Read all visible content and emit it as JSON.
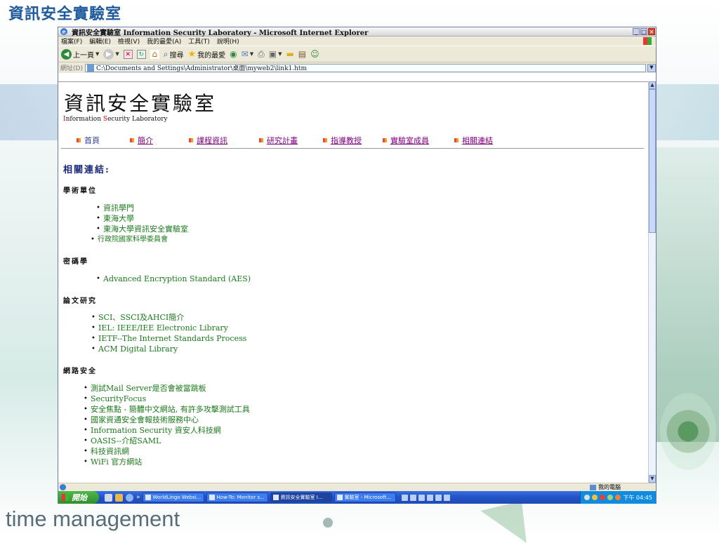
{
  "slide": {
    "title": "資訊安全實驗室",
    "footer": "time management"
  },
  "window": {
    "title": "資訊安全實驗室 Information Security Laboratory - Microsoft Internet Explorer",
    "menu": [
      "檔案(F)",
      "編輯(E)",
      "檢視(V)",
      "我的最愛(A)",
      "工具(T)",
      "說明(H)"
    ],
    "toolbar": {
      "back_label": "上一頁",
      "search_label": "搜尋",
      "favorites_label": "我的最愛"
    },
    "address": {
      "label": "網址(D)",
      "value": "C:\\Documents and Settings\\Administrator\\桌面\\myweb2\\link1.htm"
    }
  },
  "page": {
    "heading": "資訊安全實驗室",
    "subtitle_I": "I",
    "subtitle_rest1": "nformation ",
    "subtitle_S": "S",
    "subtitle_rest2": "ecurity Laboratory",
    "nav": [
      "首頁",
      "簡介",
      "課程資訊",
      "研究計畫",
      "指導教授",
      "實驗室成員",
      "相關連結"
    ],
    "section_title": "相關連結:",
    "categories": [
      {
        "name": "學術單位",
        "links": [
          "資訊學門",
          "東海大學",
          "東海大學資訊安全實驗室",
          "行政院國家科學委員會"
        ]
      },
      {
        "name": "密碼學",
        "links": [
          "Advanced Encryption Standard (AES)"
        ]
      },
      {
        "name": "論文研究",
        "links": [
          "SCI、SSCI及AHCI簡介",
          "IEL: IEEE/IEE Electronic Library",
          "IETF--The Internet Standards Process",
          "ACM Digital Library"
        ]
      },
      {
        "name": "網路安全",
        "links": [
          "測試Mail Server是否會被當跳板",
          "SecurityFocus",
          "安全焦點 - 簡體中文網站, 有許多攻擊測試工具",
          "國家資通安全會報技術服務中心",
          "Information Security 資安人科技網",
          "OASIS--介紹SAML",
          "科技資訊網",
          "WiFi 官方網站"
        ]
      }
    ]
  },
  "statusbar": {
    "zone": "我的電腦"
  },
  "taskbar": {
    "start_label": "開始",
    "buttons": [
      "WorldLingo Websi...",
      "How-To: Monitor s...",
      "資訊安全實驗室 I...",
      "實驗室 - Microsoft..."
    ],
    "clock": "下午 04:45"
  }
}
